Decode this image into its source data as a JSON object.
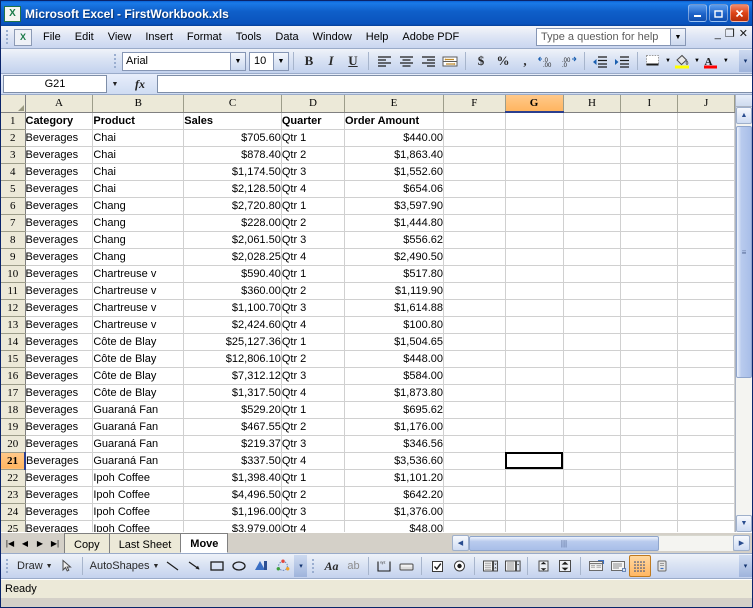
{
  "window": {
    "title": "Microsoft Excel - FirstWorkbook.xls",
    "app_icon": "excel-icon",
    "minimize": "minimize-icon",
    "restore": "restore-icon",
    "close": "close-icon"
  },
  "menu": {
    "doc_icon": "document-icon",
    "items": [
      "File",
      "Edit",
      "View",
      "Insert",
      "Format",
      "Tools",
      "Data",
      "Window",
      "Help",
      "Adobe PDF"
    ],
    "help_box_placeholder": "Type a question for help",
    "window_minimize": "_",
    "window_restore": "❐",
    "window_close": "✕"
  },
  "toolbar": {
    "font_name": "Arial",
    "font_size": "10",
    "bold": "B",
    "italic": "I",
    "underline": "U",
    "buttons": [
      "align-left-icon",
      "align-center-icon",
      "align-right-icon",
      "merge-center-icon",
      "currency-icon",
      "percent-icon",
      "comma-icon",
      "increase-decimal-icon",
      "decrease-decimal-icon",
      "decrease-indent-icon",
      "increase-indent-icon",
      "borders-icon",
      "fill-color-icon",
      "font-color-icon"
    ],
    "currency_symbol": "$",
    "percent_symbol": "%",
    "comma_symbol": ",",
    "font_color_letter": "A"
  },
  "formula_bar": {
    "name_box": "G21",
    "fx_label": "fx",
    "formula_value": ""
  },
  "sheet": {
    "columns": [
      "A",
      "B",
      "C",
      "D",
      "E",
      "F",
      "G",
      "H",
      "I",
      "J"
    ],
    "selected_column": "G",
    "selected_row": 21,
    "active_cell": "G21",
    "header_row_number": 1,
    "headers": [
      "Category",
      "Product",
      "Sales",
      "Quarter",
      "Order Amount"
    ],
    "rows": [
      {
        "n": 2,
        "category": "Beverages",
        "product": "Chai",
        "sales": "$705.60",
        "quarter": "Qtr 1",
        "amount": "$440.00"
      },
      {
        "n": 3,
        "category": "Beverages",
        "product": "Chai",
        "sales": "$878.40",
        "quarter": "Qtr 2",
        "amount": "$1,863.40"
      },
      {
        "n": 4,
        "category": "Beverages",
        "product": "Chai",
        "sales": "$1,174.50",
        "quarter": "Qtr 3",
        "amount": "$1,552.60"
      },
      {
        "n": 5,
        "category": "Beverages",
        "product": "Chai",
        "sales": "$2,128.50",
        "quarter": "Qtr 4",
        "amount": "$654.06"
      },
      {
        "n": 6,
        "category": "Beverages",
        "product": "Chang",
        "sales": "$2,720.80",
        "quarter": "Qtr 1",
        "amount": "$3,597.90"
      },
      {
        "n": 7,
        "category": "Beverages",
        "product": "Chang",
        "sales": "$228.00",
        "quarter": "Qtr 2",
        "amount": "$1,444.80"
      },
      {
        "n": 8,
        "category": "Beverages",
        "product": "Chang",
        "sales": "$2,061.50",
        "quarter": "Qtr 3",
        "amount": "$556.62"
      },
      {
        "n": 9,
        "category": "Beverages",
        "product": "Chang",
        "sales": "$2,028.25",
        "quarter": "Qtr 4",
        "amount": "$2,490.50"
      },
      {
        "n": 10,
        "category": "Beverages",
        "product": "Chartreuse v",
        "sales": "$590.40",
        "quarter": "Qtr 1",
        "amount": "$517.80"
      },
      {
        "n": 11,
        "category": "Beverages",
        "product": "Chartreuse v",
        "sales": "$360.00",
        "quarter": "Qtr 2",
        "amount": "$1,119.90"
      },
      {
        "n": 12,
        "category": "Beverages",
        "product": "Chartreuse v",
        "sales": "$1,100.70",
        "quarter": "Qtr 3",
        "amount": "$1,614.88"
      },
      {
        "n": 13,
        "category": "Beverages",
        "product": "Chartreuse v",
        "sales": "$2,424.60",
        "quarter": "Qtr 4",
        "amount": "$100.80"
      },
      {
        "n": 14,
        "category": "Beverages",
        "product": "Côte de Blay",
        "sales": "$25,127.36",
        "quarter": "Qtr 1",
        "amount": "$1,504.65"
      },
      {
        "n": 15,
        "category": "Beverages",
        "product": "Côte de Blay",
        "sales": "$12,806.10",
        "quarter": "Qtr 2",
        "amount": "$448.00"
      },
      {
        "n": 16,
        "category": "Beverages",
        "product": "Côte de Blay",
        "sales": "$7,312.12",
        "quarter": "Qtr 3",
        "amount": "$584.00"
      },
      {
        "n": 17,
        "category": "Beverages",
        "product": "Côte de Blay",
        "sales": "$1,317.50",
        "quarter": "Qtr 4",
        "amount": "$1,873.80"
      },
      {
        "n": 18,
        "category": "Beverages",
        "product": "Guaraná Fan",
        "sales": "$529.20",
        "quarter": "Qtr 1",
        "amount": "$695.62"
      },
      {
        "n": 19,
        "category": "Beverages",
        "product": "Guaraná Fan",
        "sales": "$467.55",
        "quarter": "Qtr 2",
        "amount": "$1,176.00"
      },
      {
        "n": 20,
        "category": "Beverages",
        "product": "Guaraná Fan",
        "sales": "$219.37",
        "quarter": "Qtr 3",
        "amount": "$346.56"
      },
      {
        "n": 21,
        "category": "Beverages",
        "product": "Guaraná Fan",
        "sales": "$337.50",
        "quarter": "Qtr 4",
        "amount": "$3,536.60"
      },
      {
        "n": 22,
        "category": "Beverages",
        "product": "Ipoh Coffee",
        "sales": "$1,398.40",
        "quarter": "Qtr 1",
        "amount": "$1,101.20"
      },
      {
        "n": 23,
        "category": "Beverages",
        "product": "Ipoh Coffee",
        "sales": "$4,496.50",
        "quarter": "Qtr 2",
        "amount": "$642.20"
      },
      {
        "n": 24,
        "category": "Beverages",
        "product": "Ipoh Coffee",
        "sales": "$1,196.00",
        "quarter": "Qtr 3",
        "amount": "$1,376.00"
      },
      {
        "n": 25,
        "category": "Beverages",
        "product": "Ipoh Coffee",
        "sales": "$3,979.00",
        "quarter": "Qtr 4",
        "amount": "$48.00"
      }
    ]
  },
  "tabs": {
    "nav_first": "⏮",
    "nav_prev": "◀",
    "nav_next": "▶",
    "nav_last": "⏭",
    "sheets": [
      {
        "label": "Copy",
        "active": false
      },
      {
        "label": "Last Sheet",
        "active": false
      },
      {
        "label": "Move",
        "active": true
      }
    ]
  },
  "drawing_toolbar": {
    "draw_label": "Draw",
    "autoshapes_label": "AutoShapes",
    "buttons": [
      "select-arrow-icon",
      "line-icon",
      "arrow-icon",
      "rectangle-icon",
      "oval-icon",
      "wordart-icon",
      "diagram-icon",
      "textbox-icon",
      "label-icon",
      "spin-button-icon",
      "command-button-icon",
      "check-box-icon",
      "option-button-icon",
      "list-box-icon",
      "combo-box-icon",
      "toggle-button-icon",
      "properties-icon",
      "view-code-icon",
      "design-mode-icon",
      "more-controls-icon"
    ],
    "font_letters": "Aa",
    "label_letters": "ab"
  },
  "status": {
    "text": "Ready"
  },
  "colors": {
    "titlebar": "#0a53bd",
    "selection_orange": "#ffb560",
    "header_bg": "#ece9d8",
    "grid_line": "#d0d0d0"
  }
}
